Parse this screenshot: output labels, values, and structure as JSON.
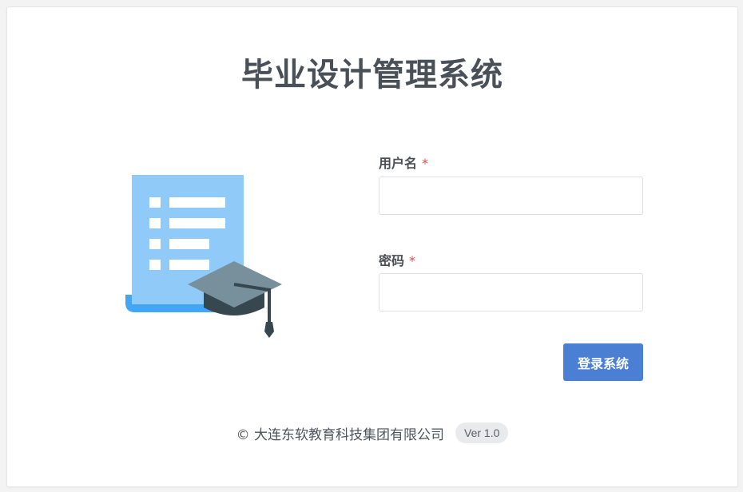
{
  "app": {
    "title": "毕业设计管理系统"
  },
  "illustration": {
    "icon": "graduation-document-icon",
    "colors": {
      "paper": "#90caf9",
      "paper_base": "#42a5f5",
      "cap_top": "#78909c",
      "cap_body": "#37474f"
    }
  },
  "form": {
    "username": {
      "label": "用户名",
      "required_mark": "*",
      "value": "",
      "placeholder": ""
    },
    "password": {
      "label": "密码",
      "required_mark": "*",
      "value": "",
      "placeholder": ""
    },
    "submit_label": "登录系统"
  },
  "footer": {
    "copyright": "© 大连东软教育科技集团有限公司",
    "version": "Ver 1.0"
  },
  "colors": {
    "primary": "#4a7fd4",
    "required": "#e04a4a",
    "title_text": "#4a5058"
  }
}
